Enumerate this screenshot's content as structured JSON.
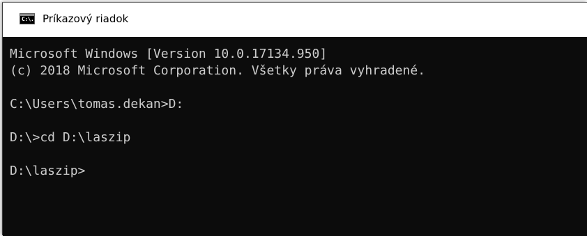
{
  "window": {
    "title": "Príkazový riadok",
    "icon": "cmd-icon",
    "icon_glyph": "C:\\."
  },
  "console": {
    "lines": [
      "Microsoft Windows [Version 10.0.17134.950]",
      "(c) 2018 Microsoft Corporation. Všetky práva vyhradené.",
      "",
      "C:\\Users\\tomas.dekan>D:",
      "",
      "D:\\>cd D:\\laszip",
      "",
      "D:\\laszip>"
    ],
    "background": "#0c0c0c",
    "foreground": "#cccccc"
  }
}
